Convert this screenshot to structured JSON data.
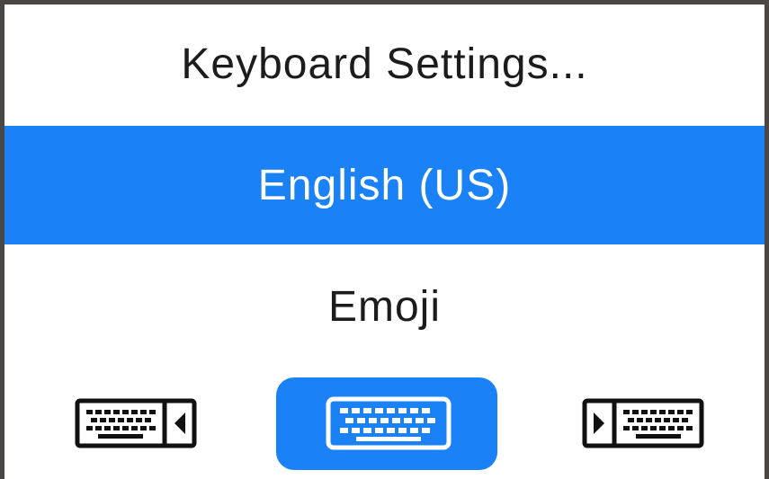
{
  "menu": {
    "settings_label": "Keyboard Settings...",
    "english_label": "English (US)",
    "emoji_label": "Emoji"
  },
  "keyboard_modes": {
    "left": "keyboard-left-handed-icon",
    "center": "keyboard-full-icon",
    "right": "keyboard-right-handed-icon",
    "selected": "center"
  },
  "colors": {
    "accent": "#1a82f6",
    "text": "#1c1c1c",
    "background": "#ffffff"
  }
}
